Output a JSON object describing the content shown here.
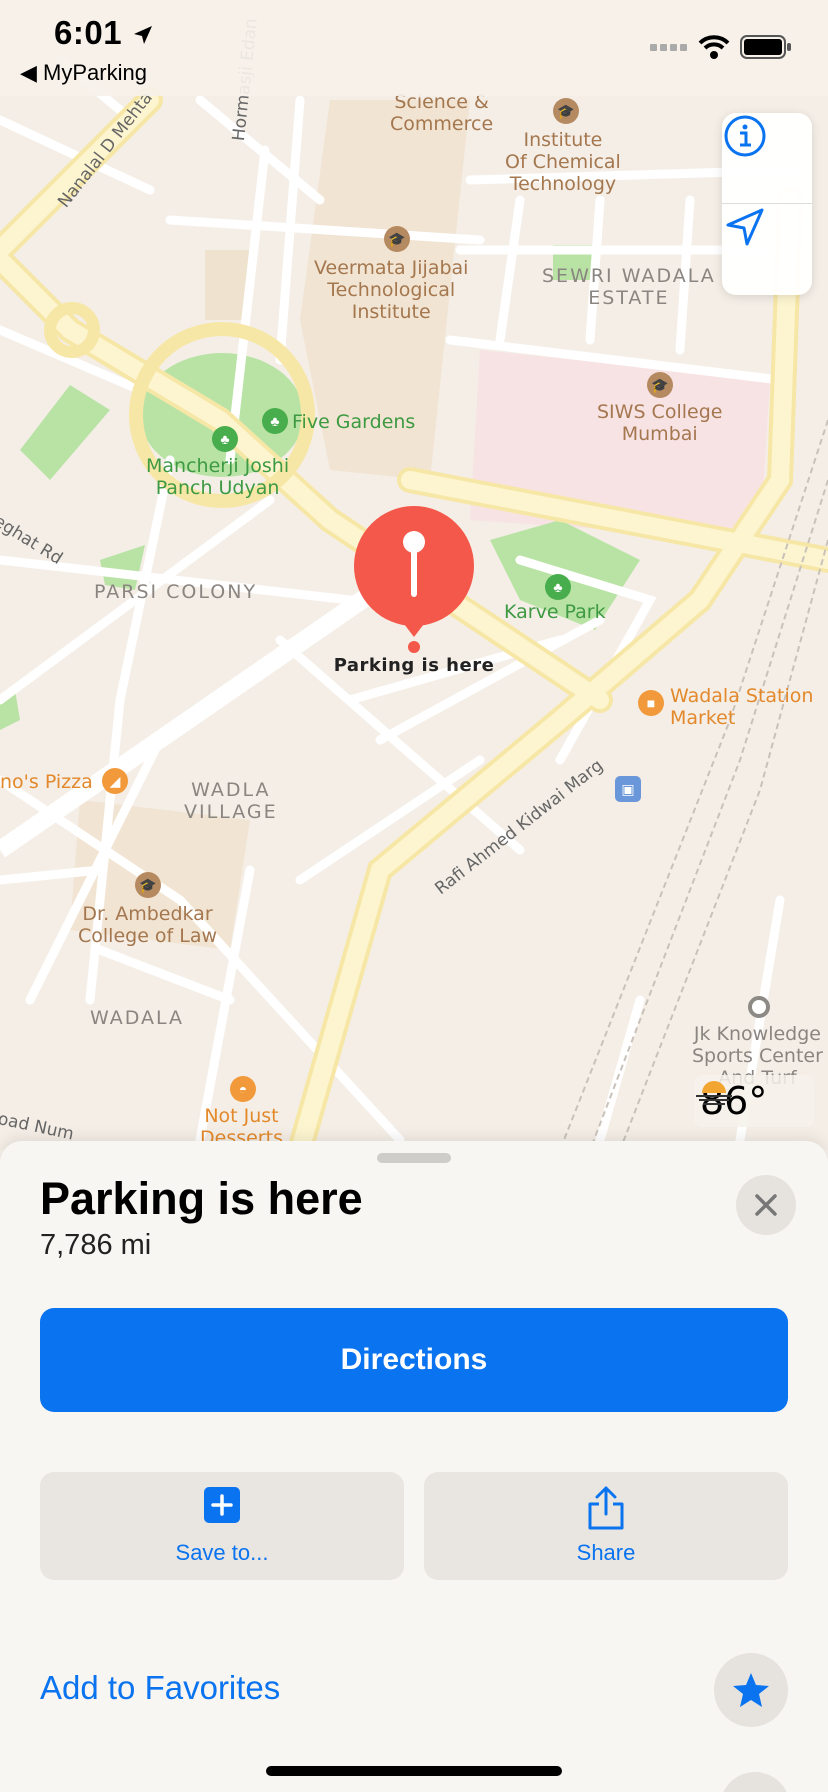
{
  "status_bar": {
    "time": "6:01",
    "back_app": "MyParking"
  },
  "map": {
    "labels": {
      "science_commerce": "Science &\nCommerce",
      "institute_chemical": "Institute\nOf Chemical\nTechnology",
      "hormasji": "Hormasji Edan",
      "nanalal": "Nanalal D Mehta",
      "veermata": "Veermata Jijabai\nTechnological\nInstitute",
      "sewri": "SEWRI WADALA\nESTATE",
      "siws": "SIWS College\nMumbai",
      "five_gardens": "Five Gardens",
      "mancherji": "Mancherji Joshi\nPanch Udyan",
      "parsi_colony": "PARSI COLONY",
      "karve_park": "Karve Park",
      "wadala_station": "Wadala Station\nMarket",
      "eghat": "eghat Rd",
      "nos_pizza": "no's Pizza",
      "wadla_village": "WADLA\nVILLAGE",
      "rafi_ahmed": "Rafi Ahmed Kidwai Marg",
      "ambedkar": "Dr. Ambedkar\nCollege of Law",
      "wadala": "WADALA",
      "jk_knowledge": "Jk Knowledge\nSports Center\nAnd Turf",
      "not_just": "Not Just\nDesserts",
      "road_num": "oad Num"
    },
    "pin_label": "Parking is here",
    "weather_temp": "86°"
  },
  "sheet": {
    "title": "Parking is here",
    "distance": "7,786 mi",
    "directions_label": "Directions",
    "save_label": "Save to...",
    "share_label": "Share",
    "favorites_label": "Add to Favorites"
  },
  "colors": {
    "accent": "#0a73ef",
    "pin": "#f4584a",
    "park": "#b9e3a5",
    "major_road": "#fbf2c2"
  }
}
